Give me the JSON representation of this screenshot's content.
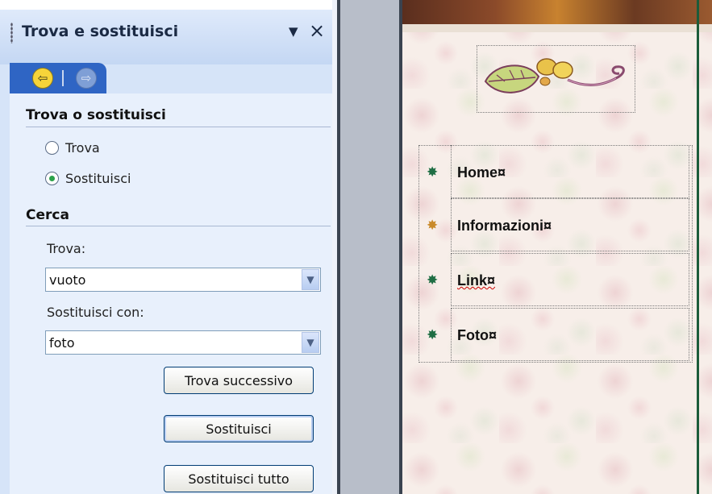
{
  "task_pane": {
    "title": "Trova e sostituisci",
    "menu_arrow": "▼",
    "close": "×",
    "nav": {
      "back_icon": "⇦",
      "forward_icon": "⇨"
    },
    "section_find_replace": "Trova o sostituisci",
    "radio_find": "Trova",
    "radio_replace": "Sostituisci",
    "selected_mode": "Sostituisci",
    "section_search": "Cerca",
    "find_label": "Trova:",
    "find_value": "vuoto",
    "replace_label": "Sostituisci con:",
    "replace_value": "foto",
    "dropdown_arrow": "▼",
    "btn_find_next": "Trova successivo",
    "btn_replace": "Sostituisci",
    "btn_replace_all": "Sostituisci tutto"
  },
  "document": {
    "menu_items": [
      {
        "label": "Home¤",
        "bullet": "✸",
        "bullet_color": "#1f6e44"
      },
      {
        "label": "Informazioni¤",
        "bullet": "✸",
        "bullet_color": "#c98a2a"
      },
      {
        "label": "Link¤",
        "bullet": "✸",
        "bullet_color": "#1f6e44"
      },
      {
        "label": "Foto¤",
        "bullet": "✸",
        "bullet_color": "#1f6e44"
      }
    ]
  },
  "colors": {
    "pane_bg": "#e8f0fc",
    "nav_blue": "#2f65c4",
    "frame_dark": "#3a4350",
    "accent_green": "#1f6e44",
    "accent_gold": "#c98a2a"
  }
}
